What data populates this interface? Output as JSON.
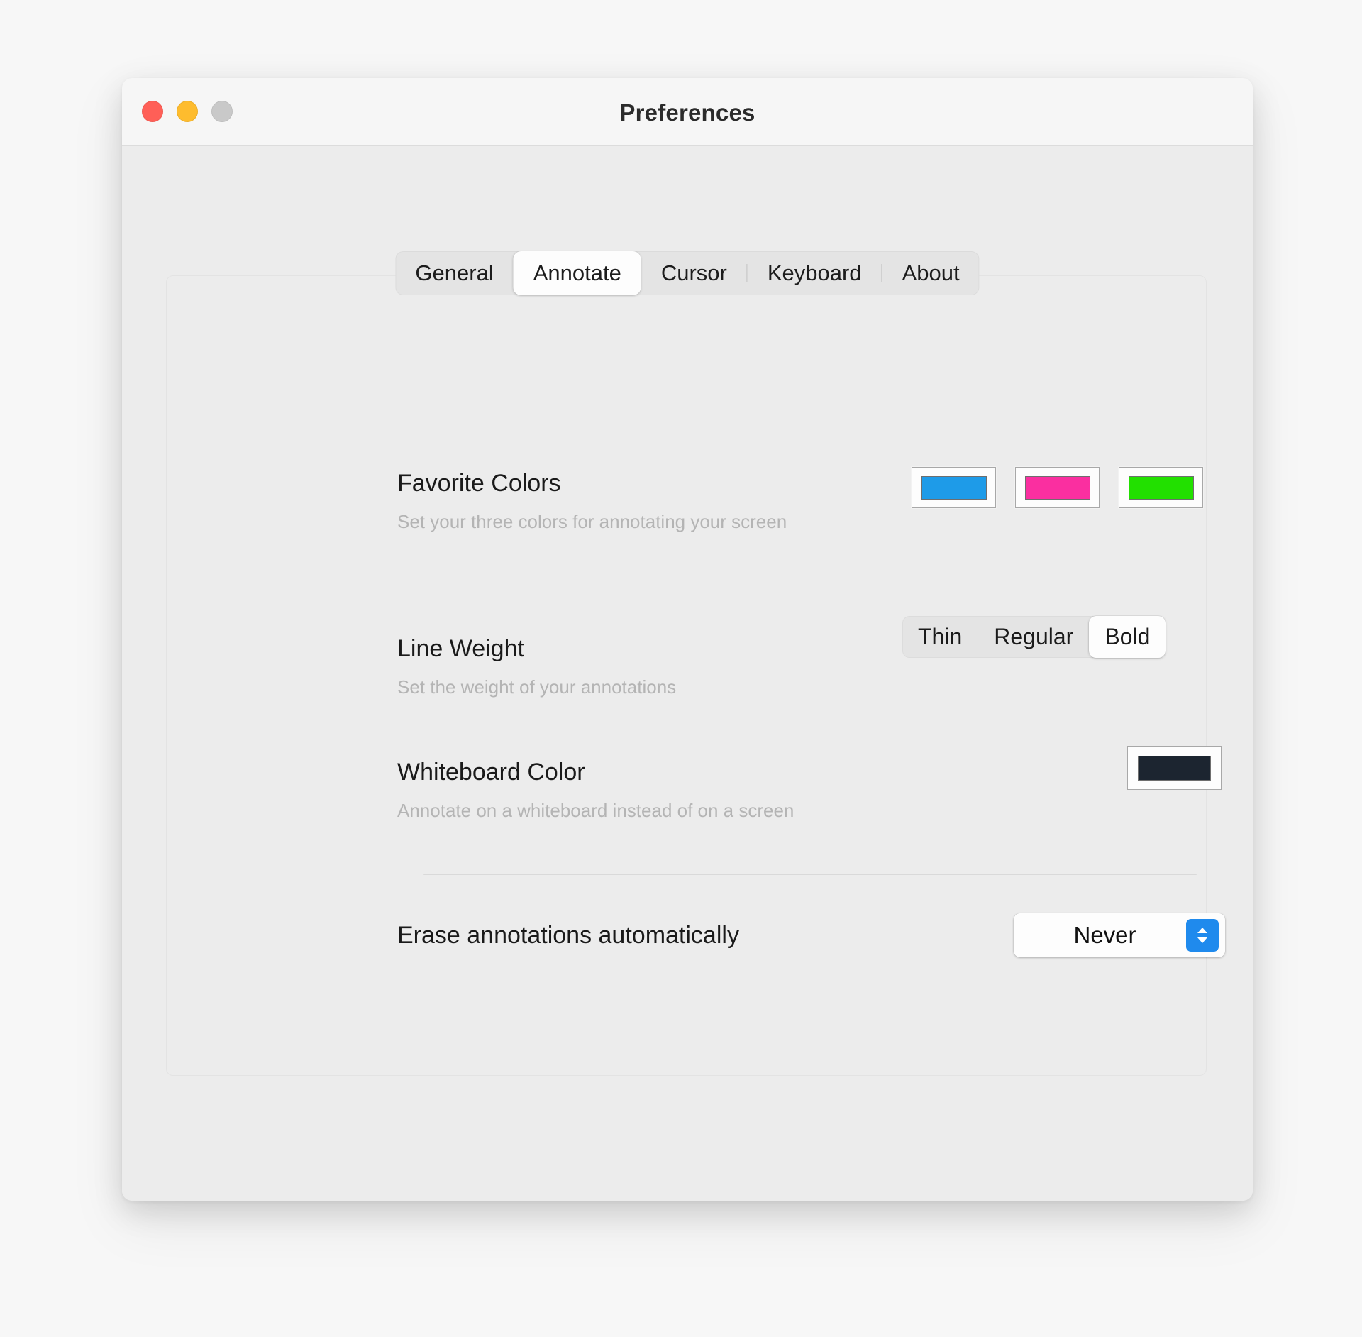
{
  "window": {
    "title": "Preferences",
    "traffic_lights": [
      {
        "name": "close",
        "color": "#ff5f57"
      },
      {
        "name": "minimize",
        "color": "#febc2e"
      },
      {
        "name": "zoom",
        "color": "#c9c9c9"
      }
    ]
  },
  "tabs": [
    {
      "label": "General",
      "selected": false,
      "separator_after": false
    },
    {
      "label": "Annotate",
      "selected": true,
      "separator_after": false
    },
    {
      "label": "Cursor",
      "selected": false,
      "separator_after": true
    },
    {
      "label": "Keyboard",
      "selected": false,
      "separator_after": true
    },
    {
      "label": "About",
      "selected": false,
      "separator_after": false
    }
  ],
  "settings": {
    "favorite_colors": {
      "title": "Favorite Colors",
      "subtitle": "Set your three colors for annotating your screen",
      "swatches": [
        {
          "name": "blue",
          "color": "#1e9be8"
        },
        {
          "name": "pink",
          "color": "#fa2fa0"
        },
        {
          "name": "green",
          "color": "#22e000"
        }
      ]
    },
    "line_weight": {
      "title": "Line Weight",
      "subtitle": "Set the weight of your annotations",
      "options": [
        "Thin",
        "Regular",
        "Bold"
      ],
      "selected": "Bold"
    },
    "whiteboard_color": {
      "title": "Whiteboard Color",
      "subtitle": "Annotate on a whiteboard instead of on a screen",
      "swatch": {
        "name": "dark-navy",
        "color": "#1c2530"
      }
    },
    "erase_annotations": {
      "title": "Erase annotations automatically",
      "value": "Never",
      "chevron_accent": "#1f8aed"
    }
  }
}
